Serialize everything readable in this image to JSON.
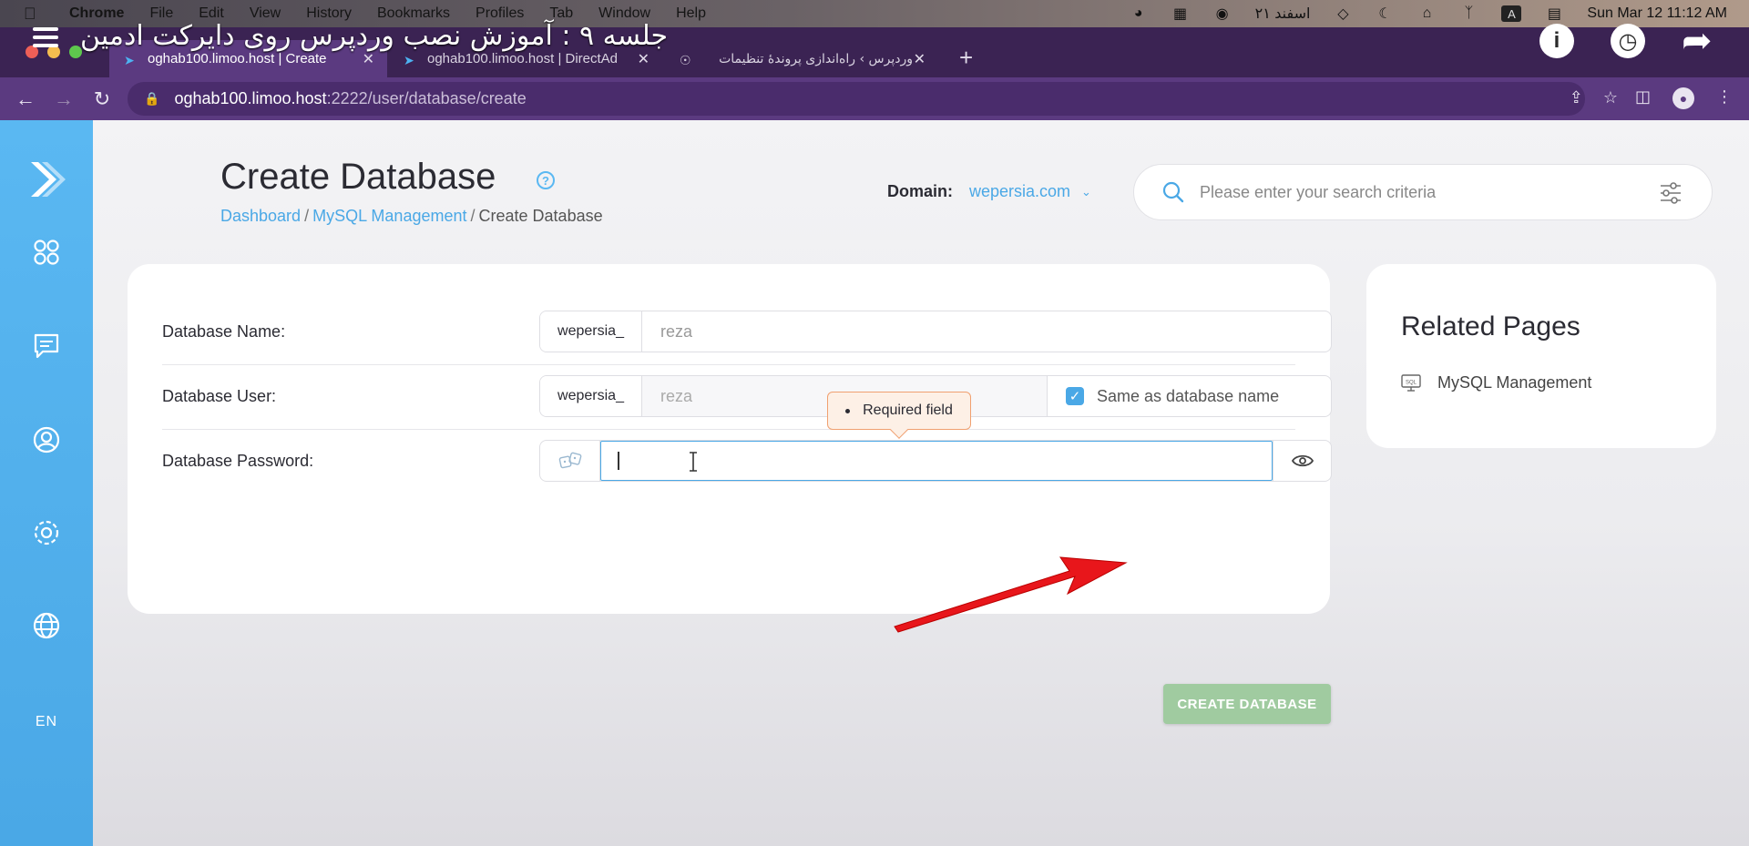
{
  "menubar": {
    "app": "Chrome",
    "items": [
      "File",
      "Edit",
      "View",
      "History",
      "Bookmarks",
      "Profiles",
      "Tab",
      "Window",
      "Help"
    ],
    "date_fa": "۲۱ اسفند",
    "input_badge": "A",
    "datetime": "Sun Mar 12  11:12 AM"
  },
  "video": {
    "title": "جلسه ۹ : آموزش نصب وردپرس روی دایرکت ادمین"
  },
  "tabs": [
    {
      "label": "oghab100.limoo.host | Create",
      "active": true
    },
    {
      "label": "oghab100.limoo.host | DirectAd",
      "active": false
    },
    {
      "label": "وردپرس › راه‌اندازی پروندهٔ تنظیمات",
      "active": false
    }
  ],
  "address": {
    "host": "oghab100.limoo.host",
    "path": ":2222/user/database/create"
  },
  "sidebar": {
    "lang": "EN"
  },
  "header": {
    "title": "Create Database",
    "breadcrumb": [
      "Dashboard",
      "MySQL Management",
      "Create Database"
    ],
    "domain_label": "Domain:",
    "domain_value": "wepersia.com",
    "search_placeholder": "Please enter your search criteria"
  },
  "form": {
    "db_name_label": "Database Name:",
    "db_name_prefix": "wepersia_",
    "db_name_value": "reza",
    "db_user_label": "Database User:",
    "db_user_prefix": "wepersia_",
    "db_user_value": "reza",
    "same_as_label": "Same as database name",
    "same_as_checked": true,
    "db_password_label": "Database Password:",
    "tooltip": "Required field",
    "submit_label": "CREATE DATABASE"
  },
  "related": {
    "title": "Related Pages",
    "links": [
      "MySQL Management"
    ]
  },
  "colors": {
    "accent": "#4aa8e6",
    "button": "#a0cba0",
    "browser": "#5b3a80",
    "tooltip_border": "#f0a070",
    "arrow": "#e8161b"
  }
}
